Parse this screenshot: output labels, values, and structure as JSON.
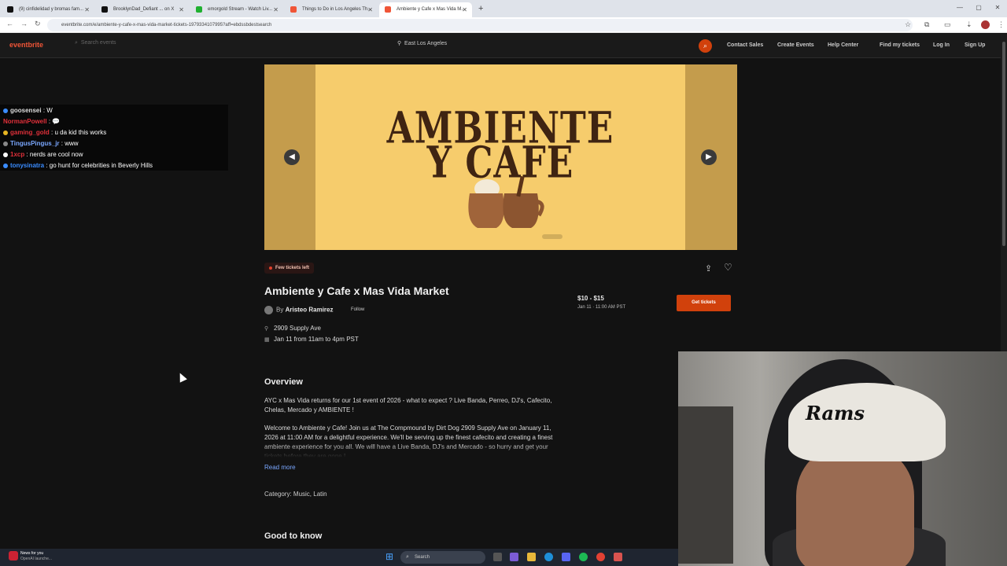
{
  "browser": {
    "tabs": [
      {
        "label": "(9) cinfidelidad y bromas fam...",
        "color": "#111111",
        "active": false
      },
      {
        "label": "BrooklynDad_Defiant ... on X",
        "color": "#111111",
        "active": false
      },
      {
        "label": "emorgold Stream - Watch Liv...",
        "color": "#20b030",
        "active": false
      },
      {
        "label": "Things to Do in Los Angeles Th...",
        "color": "#f05537",
        "active": false
      },
      {
        "label": "Ambiente y Cafe x Mas Vida M...",
        "color": "#f05537",
        "active": true
      }
    ],
    "new_tab": "+",
    "url": "eventbrite.com/e/ambiente-y-cafe-x-mas-vida-market-tickets-1979334107995?aff=ebdssbdestsearch",
    "window_buttons": [
      "—",
      "▢",
      "✕"
    ]
  },
  "header": {
    "logo": "eventbrite",
    "search_placeholder": "Search events",
    "location": "East Los Angeles",
    "links": [
      "Contact Sales",
      "Create Events",
      "Help Center",
      "Find my tickets",
      "Log In",
      "Sign Up"
    ]
  },
  "chat": [
    {
      "user": "goosensei",
      "msg": ": W",
      "color": "#dddddd"
    },
    {
      "user": "NormanPowell",
      "msg": ": 💬",
      "color": "#e0303a"
    },
    {
      "user": "gaming_gold",
      "msg": ": u da kid this works",
      "color": "#e0303a"
    },
    {
      "user": "TingusPingus_jr",
      "msg": ": www",
      "color": "#7aa7ff"
    },
    {
      "user": "1xcp",
      "msg": ": nerds are cool now",
      "color": "#e0303a"
    },
    {
      "user": "tonysinatra",
      "msg": ": go hunt for celebrities in Beverly Hills",
      "color": "#3a8cff"
    }
  ],
  "hero": {
    "line1": "AMBIENTE",
    "line2": "Y CAFE"
  },
  "event": {
    "badge": "Few tickets left",
    "title": "Ambiente y Cafe x Mas Vida Market",
    "by": "By",
    "organizer": "Aristeo Ramirez",
    "follow": "Follow",
    "address": "2909 Supply Ave",
    "date": "Jan 11 from 11am to 4pm PST",
    "price": "$10 - $15",
    "price_date": "Jan 11 · 11:00 AM PST",
    "cta": "Get tickets"
  },
  "overview": {
    "heading": "Overview",
    "p1": "AYC x Mas Vida returns for our 1st event of 2026 - what to expect ? Live Banda, Perreo, DJ's, Cafecito, Chelas, Mercado y AMBIENTE !",
    "p2": "Welcome to Ambiente y Cafe! Join us at The Compmound by Dirt Dog 2909 Supply Ave on January 11, 2026 at 11:00 AM for a delightful experience. We'll be serving up the finest cafecito and creating a finest ambiente experience for you all. We will have a Live Banda, DJ's and Mercado - so hurry and get your tickets before they are gone !",
    "read_more": "Read more",
    "category": "Category: Music, Latin",
    "good_to_know": "Good to know"
  },
  "webcam": {
    "cap_text": "Rams"
  },
  "taskbar": {
    "news": "News for you",
    "news_sub": "OpenAI launche...",
    "search": "Search"
  }
}
